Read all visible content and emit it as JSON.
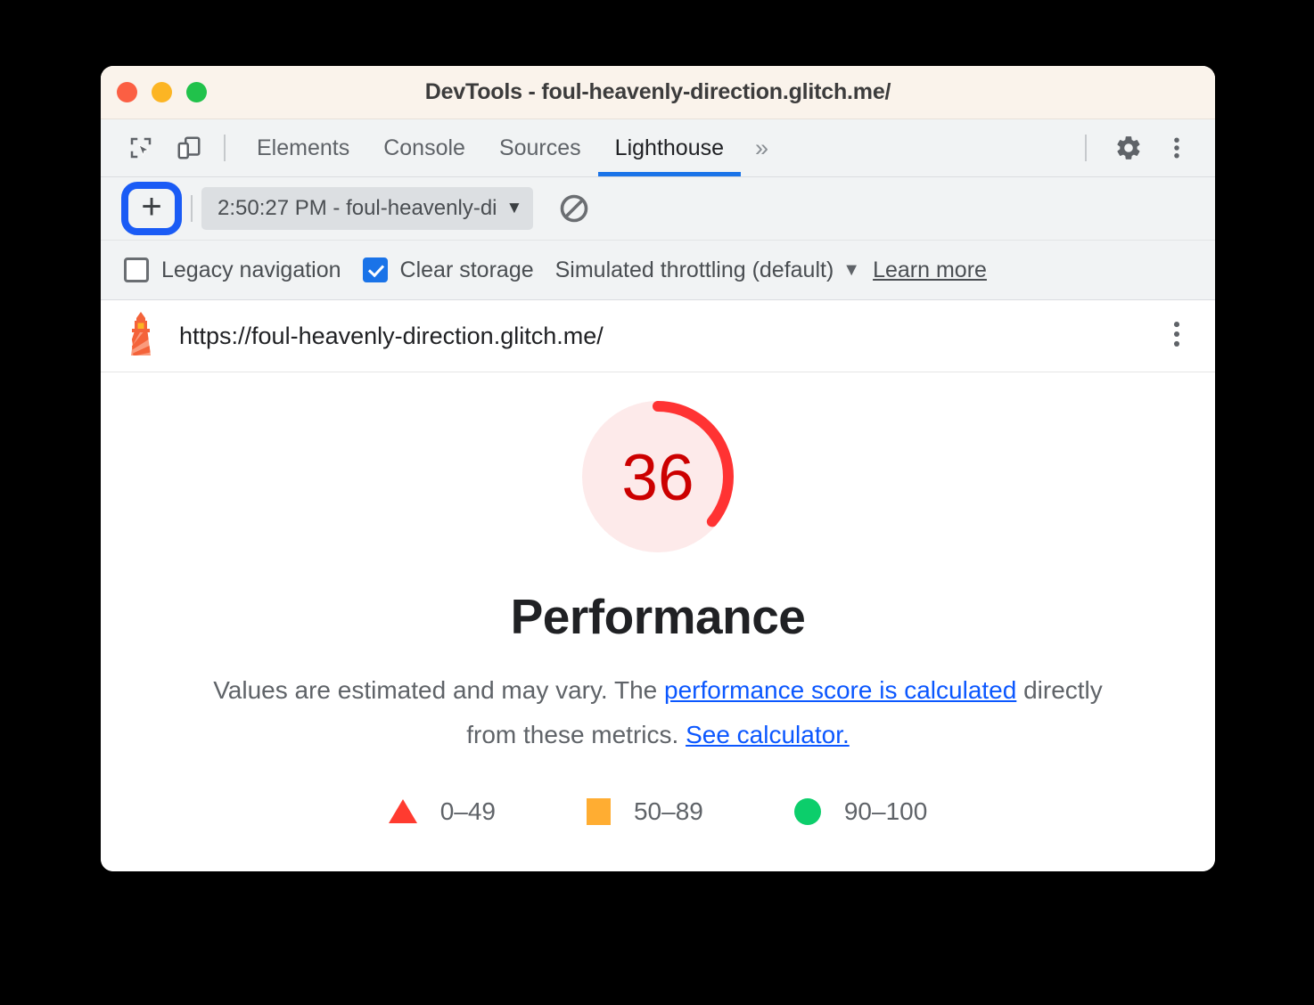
{
  "window": {
    "title": "DevTools - foul-heavenly-direction.glitch.me/",
    "traffic_lights": [
      "close",
      "minimize",
      "maximize"
    ]
  },
  "tabbar": {
    "icons": [
      "inspect-element-icon",
      "device-toolbar-icon"
    ],
    "tabs": [
      {
        "label": "Elements",
        "active": false
      },
      {
        "label": "Console",
        "active": false
      },
      {
        "label": "Sources",
        "active": false
      },
      {
        "label": "Lighthouse",
        "active": true
      }
    ],
    "overflow_label": "»",
    "right_icons": [
      "gear-icon",
      "more-vertical-icon"
    ]
  },
  "lighthouse_toolbar": {
    "add_label": "+",
    "report_select_value": "2:50:27 PM - foul-heavenly-di",
    "report_select_caret": "▼",
    "clear_icon": "no-entry-icon"
  },
  "options": {
    "legacy_navigation": {
      "label": "Legacy navigation",
      "checked": false
    },
    "clear_storage": {
      "label": "Clear storage",
      "checked": true
    },
    "throttling": {
      "label": "Simulated throttling (default)",
      "caret": "▼"
    },
    "learn_more": "Learn more"
  },
  "url_row": {
    "icon": "lighthouse-icon",
    "url": "https://foul-heavenly-direction.glitch.me/",
    "menu_icon": "more-vertical-icon"
  },
  "report": {
    "score": "36",
    "score_value": 36,
    "category": "Performance",
    "description_part1": "Values are estimated and may vary. The ",
    "description_link1": "performance score is calculated",
    "description_part2": " directly from these metrics. ",
    "description_link2": "See calculator.",
    "legend": [
      {
        "mark": "triangle",
        "label": "0–49",
        "color": "#ff3b30"
      },
      {
        "mark": "square",
        "label": "50–89",
        "color": "#ffad32"
      },
      {
        "mark": "circle",
        "label": "90–100",
        "color": "#0cce6b"
      }
    ]
  },
  "colors": {
    "accent_blue": "#1a73e8",
    "highlight_ring": "#1a5bf5",
    "score_red": "#f33",
    "score_red_text": "#cc0000",
    "gauge_track": "#fdecec",
    "link_blue": "#0b57ff"
  }
}
